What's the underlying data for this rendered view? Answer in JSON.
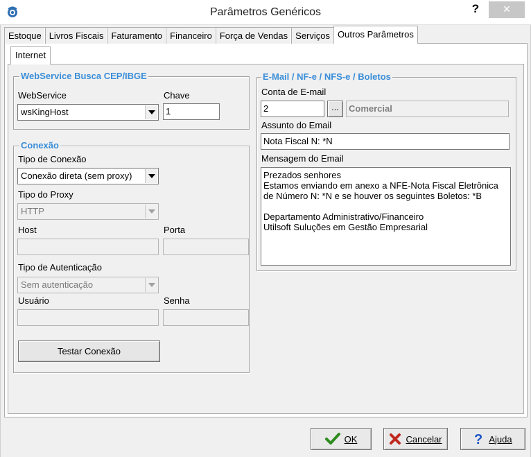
{
  "window": {
    "title": "Parâmetros Genéricos",
    "help_label": "?",
    "close_label": "✕"
  },
  "tabs": [
    {
      "label": "Estoque"
    },
    {
      "label": "Livros Fiscais"
    },
    {
      "label": "Faturamento"
    },
    {
      "label": "Financeiro"
    },
    {
      "label": "Força de Vendas"
    },
    {
      "label": "Serviços"
    },
    {
      "label": "Outros Parâmetros"
    }
  ],
  "subtab": {
    "label": "Internet"
  },
  "webservice_group": {
    "title": "WebService Busca CEP/IBGE",
    "webservice_label": "WebService",
    "webservice_value": "wsKingHost",
    "chave_label": "Chave",
    "chave_value": "1"
  },
  "conexao_group": {
    "title": "Conexão",
    "tipo_conexao_label": "Tipo de Conexão",
    "tipo_conexao_value": "Conexão direta (sem proxy)",
    "tipo_proxy_label": "Tipo do Proxy",
    "tipo_proxy_value": "HTTP",
    "host_label": "Host",
    "host_value": "",
    "porta_label": "Porta",
    "porta_value": "",
    "tipo_auth_label": "Tipo de Autenticação",
    "tipo_auth_value": "Sem autenticação",
    "usuario_label": "Usuário",
    "usuario_value": "",
    "senha_label": "Senha",
    "senha_value": "",
    "test_button": "Testar Conexão"
  },
  "email_group": {
    "title": "E-Mail / NF-e / NFS-e / Boletos",
    "conta_label": "Conta de E-mail",
    "conta_value": "2",
    "conta_browse": "...",
    "conta_name": "Comercial",
    "assunto_label": "Assunto do Email",
    "assunto_value": "Nota Fiscal N: *N",
    "mensagem_label": "Mensagem do Email",
    "mensagem_value": "Prezados senhores\nEstamos enviando em anexo a NFE-Nota Fiscal Eletrônica\nde Número N: *N e se houver os seguintes Boletos: *B\n\nDepartamento Administrativo/Financeiro\nUtilsoft Suluções em Gestão Empresarial"
  },
  "footer": {
    "ok_label": "OK",
    "cancel_label": "Cancelar",
    "help_label": "Ajuda"
  },
  "colors": {
    "legend": "#3a8ed8",
    "ok_check": "#2e8b1f",
    "cancel_x": "#c0281e",
    "help_q": "#1e55c8"
  }
}
